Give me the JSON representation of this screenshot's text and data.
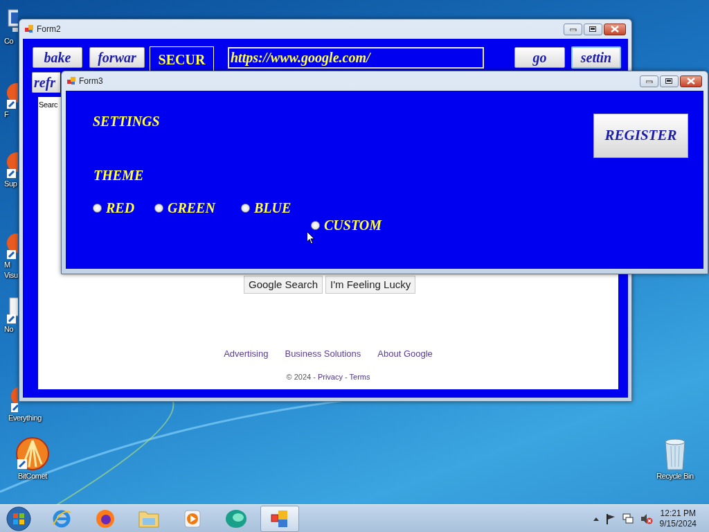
{
  "desktop_icons": [
    {
      "label": "Co"
    },
    {
      "label": "F"
    },
    {
      "label": "Sup"
    },
    {
      "label": "M Visu"
    },
    {
      "label": "No"
    },
    {
      "label": "Everything"
    },
    {
      "label": "BitComet"
    },
    {
      "label": "Recycle Bin"
    }
  ],
  "form2": {
    "title": "Form2",
    "nav_buttons": [
      "bake",
      "forwar"
    ],
    "security": "SECUR",
    "url": "https://www.google.com/",
    "go": "go",
    "settings": "settin",
    "refresh": "refr",
    "search_label": "Searc",
    "page": {
      "buttons": [
        "Google Search",
        "I'm Feeling Lucky"
      ],
      "links": [
        "Advertising",
        "Business Solutions",
        "About Google"
      ],
      "footer": {
        "prefix": "© 2024 -",
        "separator": "-",
        "links": [
          "Privacy",
          "Terms"
        ]
      }
    }
  },
  "form3": {
    "title": "Form3",
    "heading": "SETTINGS",
    "theme_label": "THEME",
    "register": "REGISTER",
    "options": [
      {
        "label": "RED",
        "selected": false
      },
      {
        "label": "GREEN",
        "selected": false
      },
      {
        "label": "BLUE",
        "selected": false
      },
      {
        "label": "CUSTOM",
        "selected": false
      }
    ]
  },
  "taskbar": {
    "time": "12:21 PM",
    "date": "9/15/2024"
  }
}
